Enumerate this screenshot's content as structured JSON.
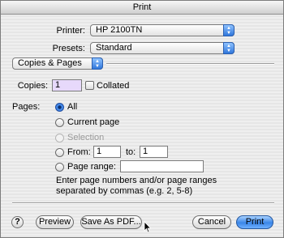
{
  "window": {
    "title": "Print"
  },
  "printer": {
    "label": "Printer:",
    "value": "HP 2100TN"
  },
  "presets": {
    "label": "Presets:",
    "value": "Standard"
  },
  "panel": {
    "value": "Copies & Pages"
  },
  "copies": {
    "label": "Copies:",
    "value": "1",
    "collated_label": "Collated",
    "collated": false
  },
  "pages": {
    "label": "Pages:",
    "options": [
      {
        "label": "All",
        "selected": true,
        "enabled": true
      },
      {
        "label": "Current page",
        "selected": false,
        "enabled": true
      },
      {
        "label": "Selection",
        "selected": false,
        "enabled": false
      },
      {
        "label": "From:",
        "selected": false,
        "enabled": true
      },
      {
        "label": "Page range:",
        "selected": false,
        "enabled": true
      }
    ],
    "from_value": "1",
    "to_label": "to:",
    "to_value": "1",
    "range_value": "",
    "help_line1": "Enter page numbers and/or page ranges",
    "help_line2": "separated by commas (e.g. 2, 5-8)"
  },
  "buttons": {
    "help": "?",
    "preview": "Preview",
    "save_pdf": "Save As PDF...",
    "cancel": "Cancel",
    "print": "Print"
  }
}
